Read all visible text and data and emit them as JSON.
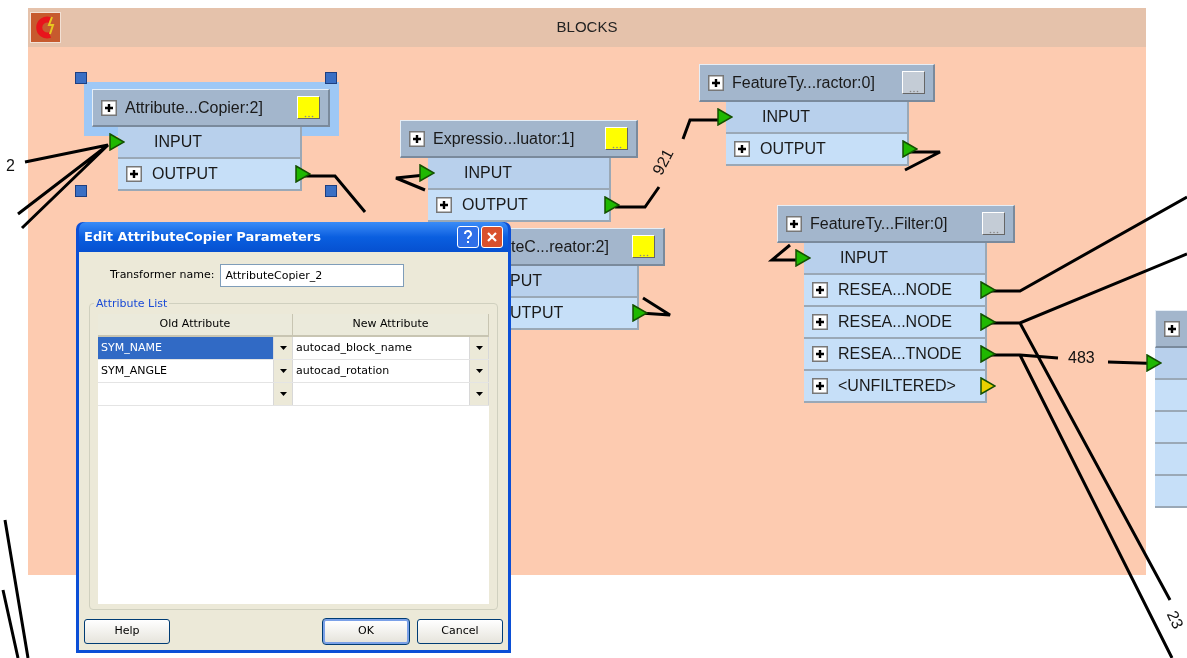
{
  "bookmark": {
    "title": "BLOCKS"
  },
  "transformers": [
    {
      "title": "Attribute...Copier:2]",
      "selected": true,
      "color": "#ffff00",
      "ports": [
        {
          "kind": "input",
          "label": "INPUT",
          "color": "#1fb800"
        },
        {
          "kind": "output",
          "label": "OUTPUT",
          "color": "#1fb800"
        }
      ]
    },
    {
      "title": "Expressio...luator:1]",
      "selected": false,
      "color": "#ffff00",
      "ports": [
        {
          "kind": "input",
          "label": "INPUT",
          "color": "#1fb800"
        },
        {
          "kind": "output",
          "label": "OUTPUT",
          "color": "#1fb800"
        }
      ]
    },
    {
      "title": "teC...reator:2]",
      "selected": false,
      "color": "#ffff00",
      "ports": [
        {
          "kind": "input",
          "label": "PUT"
        },
        {
          "kind": "output",
          "label": "UTPUT",
          "color": "#1fb800"
        }
      ]
    },
    {
      "title": "FeatureTy...ractor:0]",
      "selected": false,
      "color": "#c4ccd6",
      "ports": [
        {
          "kind": "input",
          "label": "INPUT",
          "color": "#1fb800"
        },
        {
          "kind": "output",
          "label": "OUTPUT",
          "color": "#1fb800"
        }
      ]
    },
    {
      "title": "FeatureTy...Filter:0]",
      "selected": false,
      "color": "#c4ccd6",
      "ports": [
        {
          "kind": "input",
          "label": "INPUT",
          "color": "#1fb800"
        },
        {
          "kind": "output",
          "label": "RESEA...NODE",
          "color": "#1fb800"
        },
        {
          "kind": "output",
          "label": "RESEA...NODE",
          "color": "#1fb800"
        },
        {
          "kind": "output",
          "label": "RESEA...TNODE",
          "color": "#1fb800"
        },
        {
          "kind": "output",
          "label": "<UNFILTERED>",
          "color": "#e8d000"
        }
      ]
    },
    {
      "selected": false,
      "ports": [
        {
          "kind": "input",
          "color": "#1fb800"
        },
        {
          "kind": "output"
        },
        {
          "kind": "output"
        },
        {
          "kind": "output"
        },
        {
          "kind": "output"
        }
      ]
    }
  ],
  "connection_labels": [
    "2",
    "921",
    "483",
    "23"
  ],
  "dialog": {
    "title": "Edit AttributeCopier Parameters",
    "name_label": "Transformer name:",
    "name_value": "AttributeCopier_2",
    "group_title": "Attribute List",
    "columns": [
      "Old Attribute",
      "New Attribute"
    ],
    "rows": [
      {
        "selected": true,
        "cells": [
          "SYM_NAME",
          "autocad_block_name"
        ]
      },
      {
        "selected": false,
        "cells": [
          "SYM_ANGLE",
          "autocad_rotation"
        ]
      },
      {
        "selected": false
      }
    ],
    "buttons": [
      {
        "label": "Help",
        "default": false
      },
      {
        "label": "OK",
        "default": true
      },
      {
        "label": "Cancel",
        "default": false
      }
    ]
  }
}
